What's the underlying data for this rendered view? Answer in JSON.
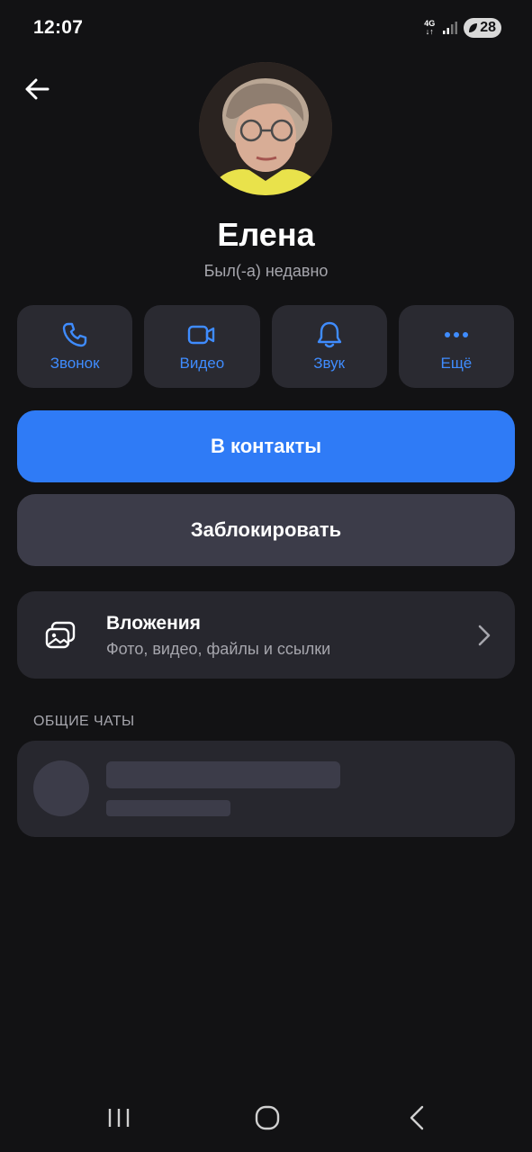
{
  "status_bar": {
    "time": "12:07",
    "network_top": "4G",
    "network_bottom": "↓↑",
    "battery": "28"
  },
  "profile": {
    "name": "Елена",
    "status": "Был(-а) недавно"
  },
  "actions": [
    {
      "label": "Звонок",
      "icon": "phone-icon"
    },
    {
      "label": "Видео",
      "icon": "video-icon"
    },
    {
      "label": "Звук",
      "icon": "bell-icon"
    },
    {
      "label": "Ещё",
      "icon": "more-dots-icon"
    }
  ],
  "buttons": {
    "add_contact": "В контакты",
    "block": "Заблокировать"
  },
  "attachments": {
    "title": "Вложения",
    "subtitle": "Фото, видео, файлы и ссылки",
    "icon": "gallery-icon"
  },
  "common_chats": {
    "title": "ОБЩИЕ ЧАТЫ"
  },
  "colors": {
    "accent": "#3f8cff",
    "primary_button": "#2f7bf6",
    "secondary_button": "#3c3c49",
    "card": "#27272e",
    "background": "#121214"
  }
}
